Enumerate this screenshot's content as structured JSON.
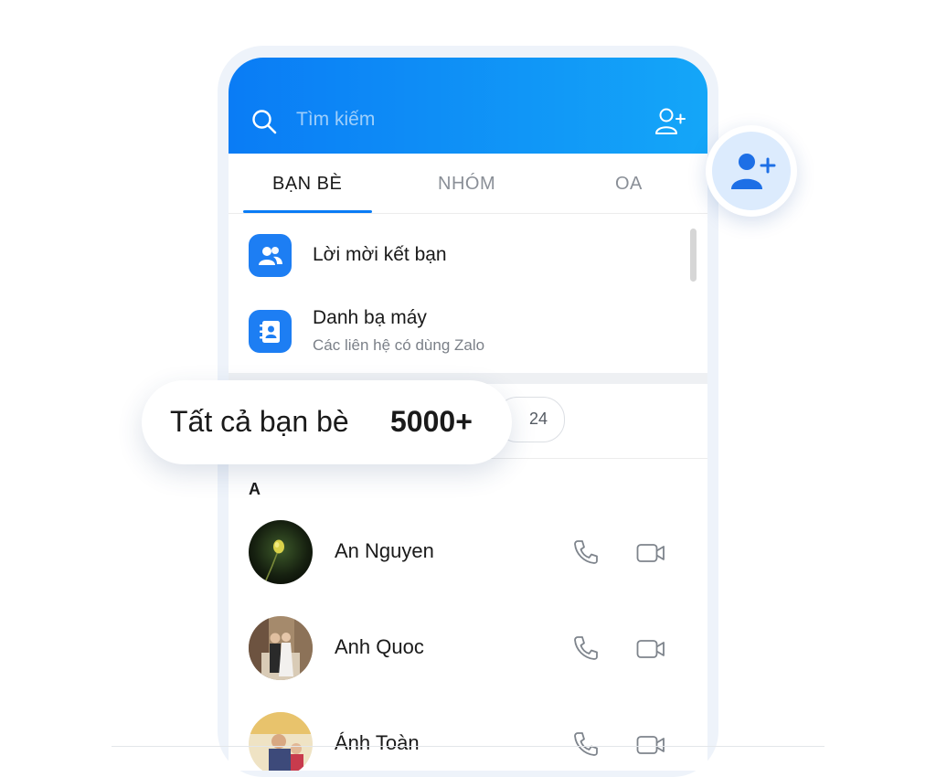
{
  "search": {
    "placeholder": "Tìm kiếm"
  },
  "tabs": [
    {
      "label": "BẠN BÈ",
      "active": true
    },
    {
      "label": "NHÓM",
      "active": false
    },
    {
      "label": "OA",
      "active": false
    }
  ],
  "menu": [
    {
      "title": "Lời mời kết bạn",
      "icon": "friend-requests-icon"
    },
    {
      "title": "Danh bạ máy",
      "subtitle": "Các liên hệ có dùng Zalo",
      "icon": "phonebook-icon"
    }
  ],
  "filter": {
    "recent_count": "24"
  },
  "overlay": {
    "label": "Tất cả bạn bè",
    "count": "5000+"
  },
  "section_letter": "A",
  "contacts": [
    {
      "name": "An Nguyen"
    },
    {
      "name": "Anh Quoc"
    },
    {
      "name": "Ánh Toàn"
    }
  ],
  "colors": {
    "accent": "#0a7cf5",
    "header_gradient_end": "#14a6f8",
    "menu_icon_bg": "#1d7ef3",
    "fab_bg": "#dcebfd"
  }
}
